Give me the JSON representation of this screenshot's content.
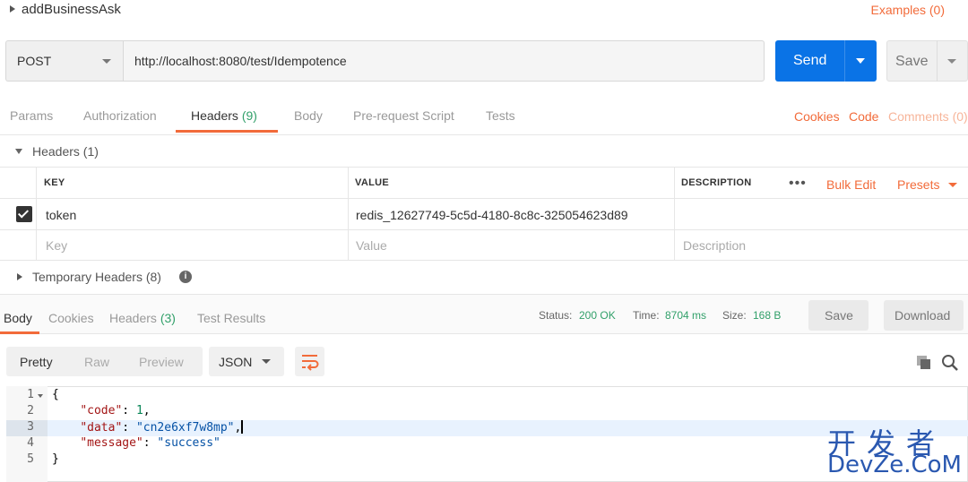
{
  "request": {
    "name": "addBusinessAsk",
    "examples_label": "Examples (0)",
    "method": "POST",
    "url": "http://localhost:8080/test/Idempotence",
    "send_label": "Send",
    "save_label": "Save"
  },
  "request_tabs": {
    "params": "Params",
    "authorization": "Authorization",
    "headers": "Headers",
    "headers_count": "(9)",
    "body": "Body",
    "prerequest": "Pre-request Script",
    "tests": "Tests",
    "cookies": "Cookies",
    "code": "Code",
    "comments": "Comments (0)"
  },
  "headers_section": {
    "title": "Headers (1)",
    "columns": {
      "key": "KEY",
      "value": "VALUE",
      "description": "DESCRIPTION"
    },
    "more_label": "•••",
    "bulk_edit": "Bulk Edit",
    "presets": "Presets",
    "rows": [
      {
        "key": "token",
        "value": "redis_12627749-5c5d-4180-8c8c-325054623d89",
        "description": "",
        "checked": true
      }
    ],
    "placeholders": {
      "key": "Key",
      "value": "Value",
      "description": "Description"
    },
    "temporary_title": "Temporary Headers (8)",
    "info_icon_glyph": "i"
  },
  "response": {
    "tabs": {
      "body": "Body",
      "cookies": "Cookies",
      "headers": "Headers",
      "headers_count": "(3)",
      "test_results": "Test Results"
    },
    "status_label": "Status:",
    "status_value": "200 OK",
    "time_label": "Time:",
    "time_value": "8704 ms",
    "size_label": "Size:",
    "size_value": "168 B",
    "save_label": "Save",
    "download_label": "Download",
    "format": {
      "pretty": "Pretty",
      "raw": "Raw",
      "preview": "Preview",
      "type": "JSON"
    },
    "code_lines": [
      {
        "n": "1",
        "text": "{"
      },
      {
        "n": "2",
        "key": "\"code\"",
        "val": "1",
        "kind": "num",
        "trail": ","
      },
      {
        "n": "3",
        "key": "\"data\"",
        "val": "\"cn2e6xf7w8mp\"",
        "kind": "str",
        "trail": ","
      },
      {
        "n": "4",
        "key": "\"message\"",
        "val": "\"success\"",
        "kind": "str",
        "trail": ""
      },
      {
        "n": "5",
        "text": "}"
      }
    ]
  },
  "watermark": {
    "top": "开发者",
    "bottom": "DevZe.CoM"
  },
  "colors": {
    "accent": "#f26b3a",
    "send": "#0a73e6",
    "success": "#32a06a"
  }
}
